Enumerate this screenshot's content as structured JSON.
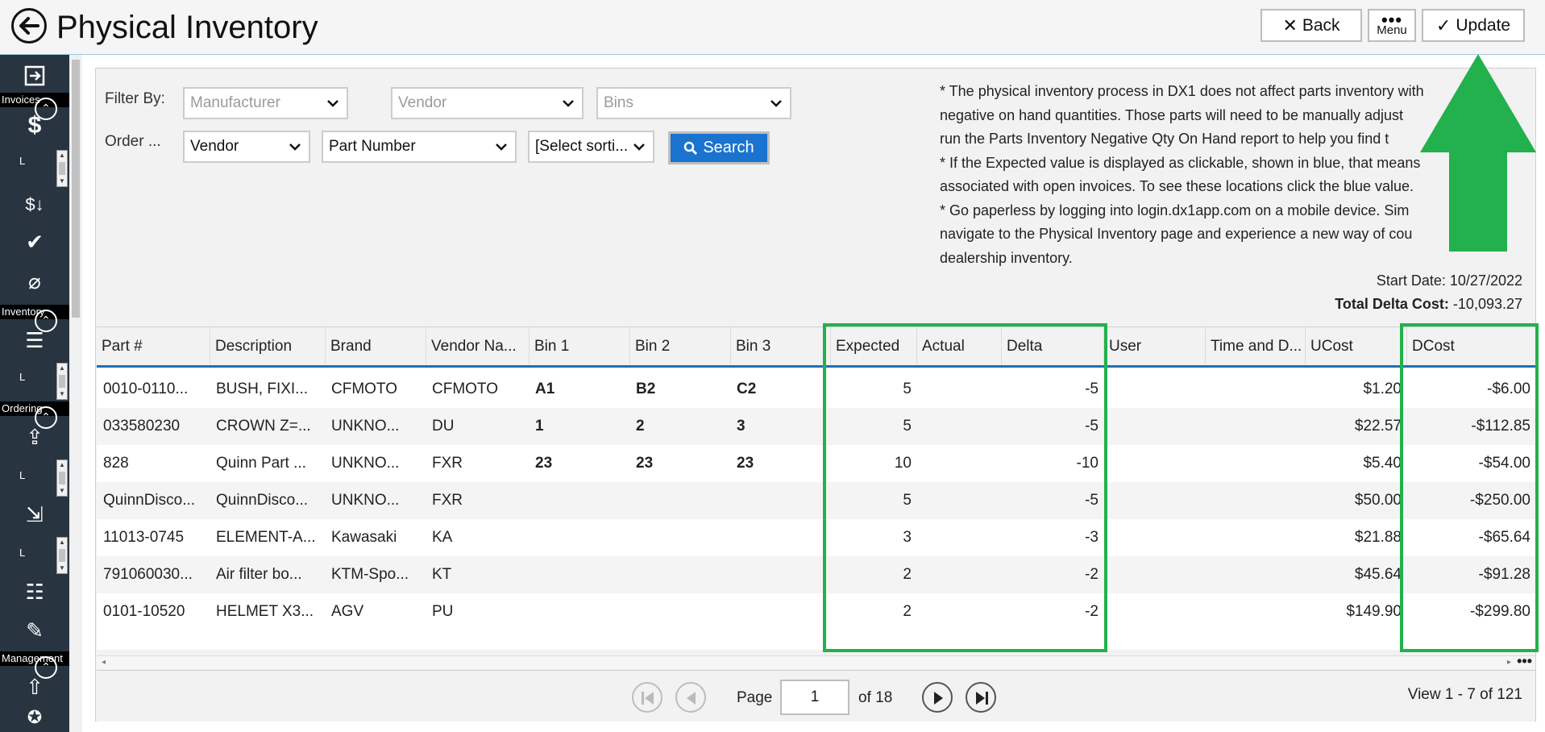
{
  "header": {
    "title": "Physical Inventory",
    "back_label": "Back",
    "menu_label": "Menu",
    "update_label": "Update"
  },
  "sidebar": {
    "sections": {
      "invoices": "Invoices",
      "inventory": "Inventory",
      "ordering": "Ordering",
      "management": "Management"
    },
    "l_marker": "L"
  },
  "filters": {
    "filter_by_label": "Filter By:",
    "order_label": "Order ...",
    "manufacturer_placeholder": "Manufacturer",
    "vendor_placeholder": "Vendor",
    "bins_placeholder": "Bins",
    "order1_value": "Vendor",
    "order2_value": "Part Number",
    "order3_value": "[Select sorti...",
    "search_label": "Search"
  },
  "notes": [
    "* The physical inventory process in DX1 does not affect parts inventory with negative on hand quantities. Those parts will need to be manually adjust... run the Parts Inventory Negative Qty On Hand report to help you find t...",
    "* If the Expected value is displayed as clickable, shown in blue, that means... associated with open invoices. To see these locations click the blue value.",
    "* Go paperless by logging into login.dx1app.com on a mobile device. Sim... navigate to the Physical Inventory page and experience a new way of cou... dealership inventory."
  ],
  "notes_lines": [
    "* The physical inventory process in DX1 does not affect parts inventory with",
    "negative on hand quantities. Those parts will need to be manually adjust",
    "run the Parts Inventory Negative Qty On Hand report to help you find t",
    "* If the Expected value is displayed as clickable, shown in blue, that means",
    "associated with open invoices. To see these locations click the blue value.",
    "* Go paperless by logging into login.dx1app.com on a mobile device. Sim",
    "navigate to the Physical Inventory page and experience a new way of cou",
    "dealership inventory."
  ],
  "summary": {
    "start_date_label": "Start Date:",
    "start_date": "10/27/2022",
    "total_delta_label": "Total Delta Cost:",
    "total_delta": "-10,093.27"
  },
  "table": {
    "columns": [
      "Part #",
      "Description",
      "Brand",
      "Vendor Na...",
      "Bin 1",
      "Bin 2",
      "Bin 3",
      "Expected",
      "Actual",
      "Delta",
      "User",
      "Time and D...",
      "UCost",
      "DCost"
    ],
    "rows": [
      [
        "0010-0110...",
        "BUSH, FIXI...",
        "CFMOTO",
        "CFMOTO",
        "A1",
        "B2",
        "C2",
        "5",
        "",
        "-5",
        "",
        "",
        "$1.20",
        "-$6.00"
      ],
      [
        "033580230",
        "CROWN Z=...",
        "UNKNO...",
        "DU",
        "1",
        "2",
        "3",
        "5",
        "",
        "-5",
        "",
        "",
        "$22.57",
        "-$112.85"
      ],
      [
        "828",
        "Quinn Part ...",
        "UNKNO...",
        "FXR",
        "23",
        "23",
        "23",
        "10",
        "",
        "-10",
        "",
        "",
        "$5.40",
        "-$54.00"
      ],
      [
        "QuinnDisco...",
        "QuinnDisco...",
        "UNKNO...",
        "FXR",
        "",
        "",
        "",
        "5",
        "",
        "-5",
        "",
        "",
        "$50.00",
        "-$250.00"
      ],
      [
        "11013-0745",
        "ELEMENT-A...",
        "Kawasaki",
        "KA",
        "",
        "",
        "",
        "3",
        "",
        "-3",
        "",
        "",
        "$21.88",
        "-$65.64"
      ],
      [
        "791060030...",
        "Air filter bo...",
        "KTM-Spo...",
        "KT",
        "",
        "",
        "",
        "2",
        "",
        "-2",
        "",
        "",
        "$45.64",
        "-$91.28"
      ],
      [
        "0101-10520",
        "HELMET X3...",
        "AGV",
        "PU",
        "",
        "",
        "",
        "2",
        "",
        "-2",
        "",
        "",
        "$149.90",
        "-$299.80"
      ]
    ]
  },
  "pager": {
    "page_label": "Page",
    "page_value": "1",
    "of_label": "of 18",
    "view_label": "View 1 - 7 of 121"
  },
  "colors": {
    "highlight": "#22b14c",
    "accent": "#1a73cf",
    "sidebar": "#283540"
  }
}
